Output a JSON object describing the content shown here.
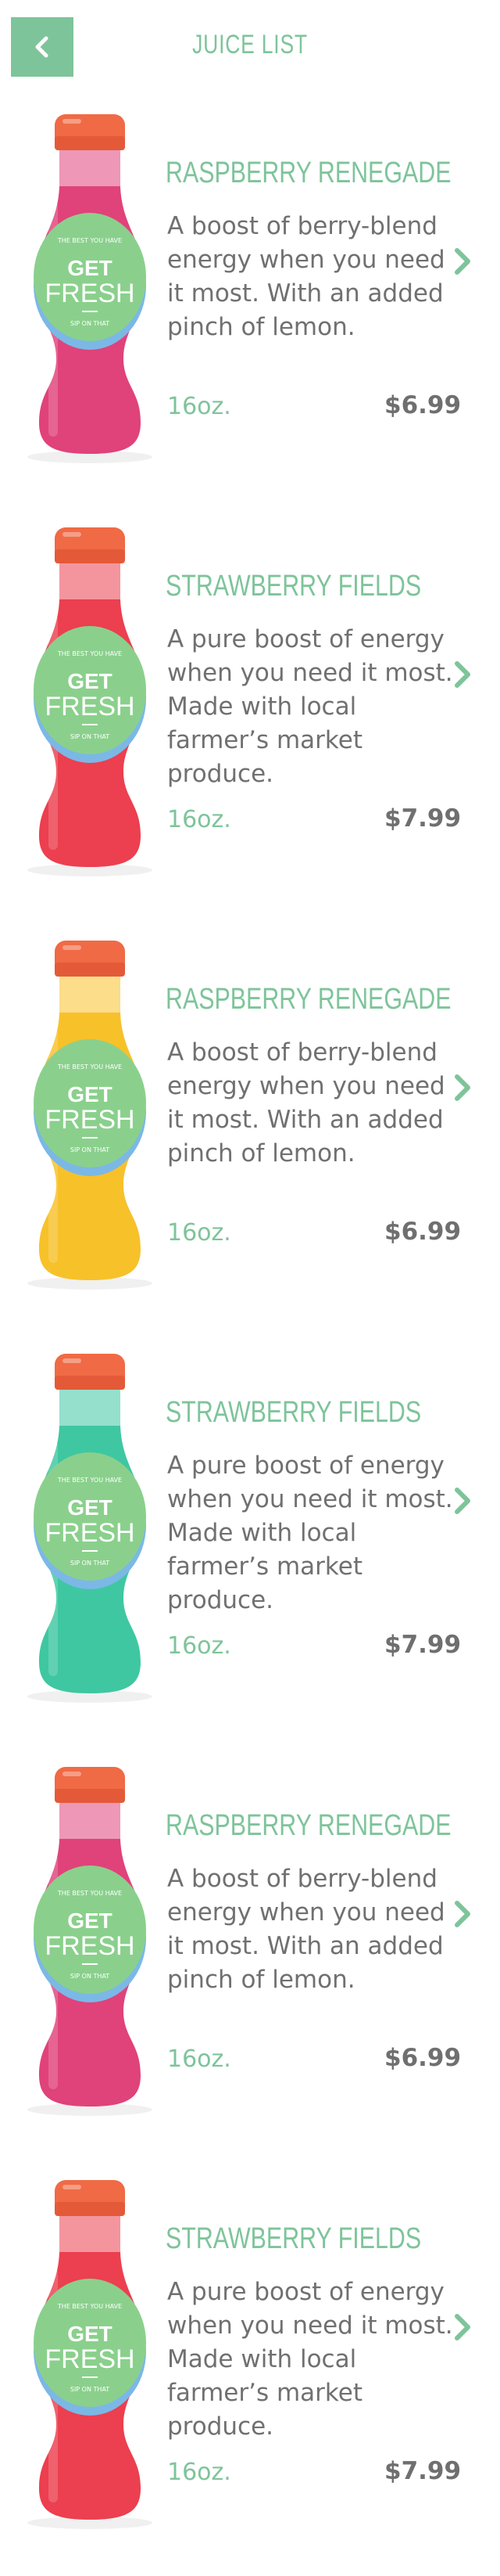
{
  "header": {
    "title": "JUICE LIST"
  },
  "colors": {
    "accent": "#7ec49a",
    "text": "#707070",
    "cap": "#f06a45",
    "label_green": "#8ad08c",
    "label_blue": "#7bb8e6"
  },
  "items": [
    {
      "name": "RASPBERRY RENEGADE",
      "description": "A boost of berry-blend energy when you need it most. With an added pinch of lemon.",
      "size": "16oz.",
      "price": "$6.99",
      "juice_color": "#e0427a"
    },
    {
      "name": "STRAWBERRY FIELDS",
      "description": "A pure boost of energy when you need it most. Made with local farmer’s market produce.",
      "size": "16oz.",
      "price": "$7.99",
      "juice_color": "#ec3f4f"
    },
    {
      "name": "RASPBERRY RENEGADE",
      "description": "A boost of berry-blend energy when you need it most. With an added pinch of lemon.",
      "size": "16oz.",
      "price": "$6.99",
      "juice_color": "#f7c12a"
    },
    {
      "name": "STRAWBERRY FIELDS",
      "description": "A pure boost of energy when you need it most. Made with local farmer’s market produce.",
      "size": "16oz.",
      "price": "$7.99",
      "juice_color": "#3fc7a2"
    },
    {
      "name": "RASPBERRY RENEGADE",
      "description": "A boost of berry-blend energy when you need it most. With an added pinch of lemon.",
      "size": "16oz.",
      "price": "$6.99",
      "juice_color": "#e0427a"
    },
    {
      "name": "STRAWBERRY FIELDS",
      "description": "A pure boost of energy when you need it most. Made with local farmer’s market produce.",
      "size": "16oz.",
      "price": "$7.99",
      "juice_color": "#ec3f4f"
    }
  ],
  "bottle_label": {
    "top_text": "THE BEST YOU HAVE",
    "line1": "GET",
    "line2": "FRESH",
    "bottom_text": "SIP ON THAT"
  }
}
